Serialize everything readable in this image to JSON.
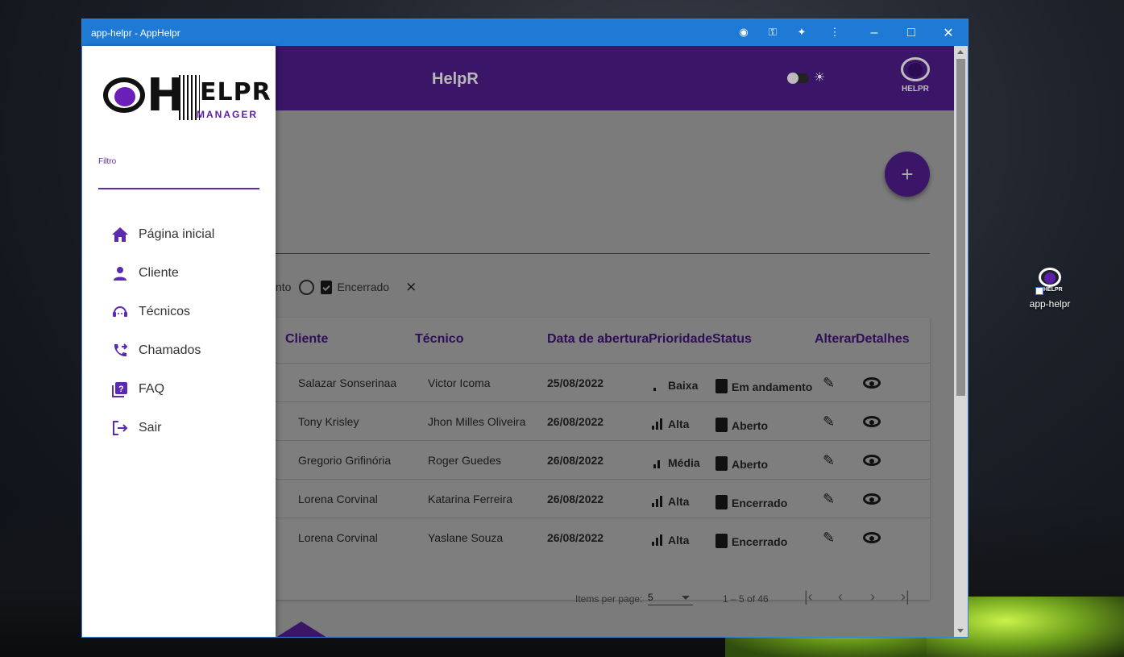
{
  "window": {
    "title": "app-helpr - AppHelpr"
  },
  "desktop": {
    "icon_label": "app-helpr",
    "icon_text": "HELPR"
  },
  "appbar": {
    "brand": "HelpR",
    "logo_text": "HELPR"
  },
  "drawer": {
    "logo": {
      "main": "ELPR",
      "big_letter": "H",
      "sub": "MANAGER"
    },
    "filter_label": "Filtro",
    "filter_value": "",
    "items": [
      {
        "label": "Página inicial",
        "icon": "home-icon"
      },
      {
        "label": "Cliente",
        "icon": "person-icon"
      },
      {
        "label": "Técnicos",
        "icon": "support-agent-icon"
      },
      {
        "label": "Chamados",
        "icon": "phone-forwarded-icon"
      },
      {
        "label": "FAQ",
        "icon": "help-box-icon"
      },
      {
        "label": "Sair",
        "icon": "logout-icon"
      }
    ]
  },
  "fab": {
    "label": "+"
  },
  "filters": {
    "partial_label": "nto",
    "closed_label": "Encerrado"
  },
  "table": {
    "headers": [
      "Cliente",
      "Técnico",
      "Data de abertura",
      "Prioridade",
      "Status",
      "Alterar",
      "Detalhes"
    ],
    "rows": [
      {
        "cliente": "Salazar Sonserinaa",
        "tecnico": "Victor Icoma",
        "data": "25/08/2022",
        "prioridade": "Baixa",
        "status": "Em andamento"
      },
      {
        "cliente": "Tony Krisley",
        "tecnico": "Jhon Milles Oliveira",
        "data": "26/08/2022",
        "prioridade": "Alta",
        "status": "Aberto"
      },
      {
        "cliente": "Gregorio Grifinória",
        "tecnico": "Roger Guedes",
        "data": "26/08/2022",
        "prioridade": "Média",
        "status": "Aberto"
      },
      {
        "cliente": "Lorena Corvinal",
        "tecnico": "Katarina Ferreira",
        "data": "26/08/2022",
        "prioridade": "Alta",
        "status": "Encerrado"
      },
      {
        "cliente": "Lorena Corvinal",
        "tecnico": "Yaslane Souza",
        "data": "26/08/2022",
        "prioridade": "Alta",
        "status": "Encerrado"
      }
    ]
  },
  "paginator": {
    "items_per_page_label": "Items per page:",
    "page_size": "5",
    "range": "1 – 5 of 46"
  },
  "colors": {
    "primary": "#5b2ab0",
    "titlebar": "#1f7ad6",
    "appbar_dimmed": "#3a1568"
  }
}
